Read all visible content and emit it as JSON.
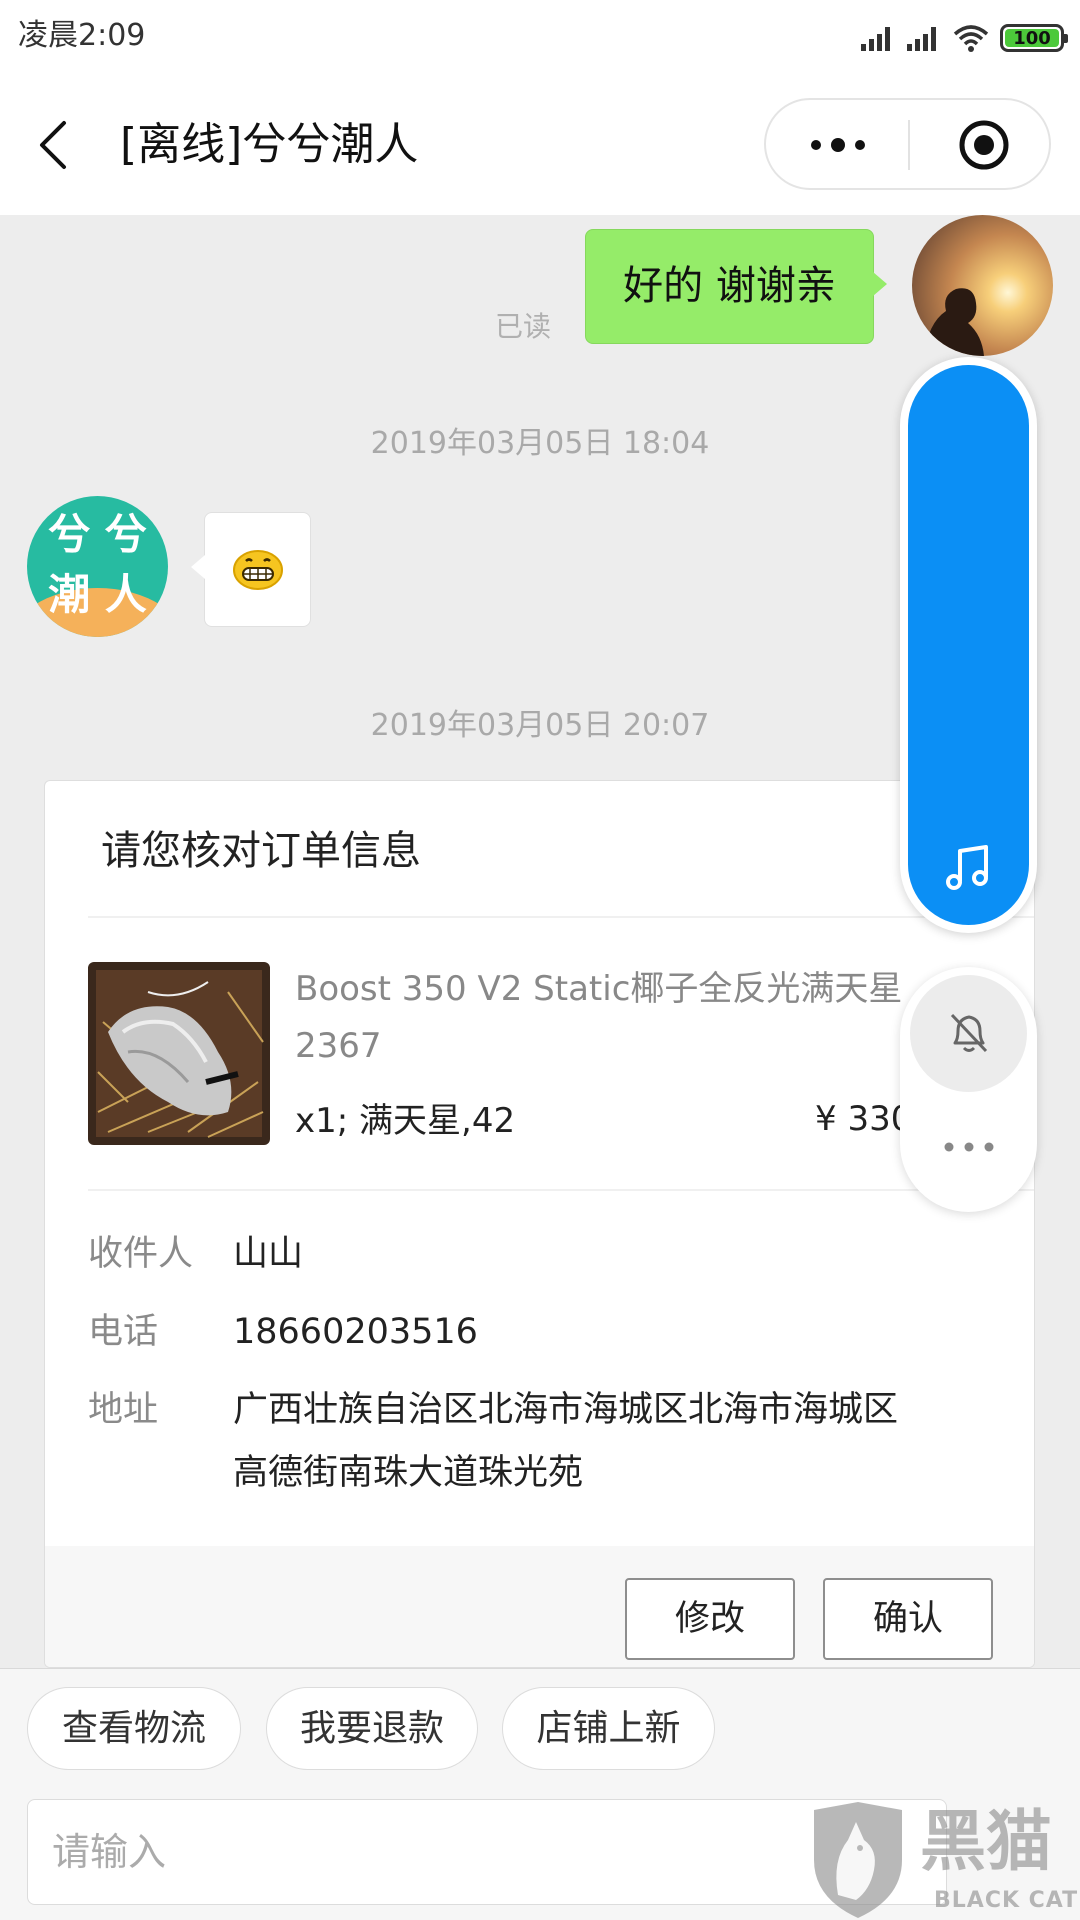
{
  "status_bar": {
    "time": "凌晨2:09",
    "battery": "100",
    "icons": [
      "signal-icon",
      "signal-icon",
      "wifi-icon",
      "battery-icon"
    ]
  },
  "header": {
    "title": "[离线]兮兮潮人",
    "icons": {
      "back": "back-arrow-icon",
      "more": "more-dots-icon",
      "close": "target-circle-icon"
    }
  },
  "chat": {
    "outgoing": {
      "text": "好的 谢谢亲",
      "read_status": "已读"
    },
    "timestamp_1": "2019年03月05日 18:04",
    "shop_avatar": [
      "兮 兮",
      "潮 人"
    ],
    "incoming_emoji": "grinning-emoji",
    "timestamp_2": "2019年03月05日 20:07"
  },
  "order_card": {
    "title": "请您核对订单信息",
    "product": {
      "name_lines": [
        "Boost 350 V2 Static椰子全反光满天星",
        "2367"
      ],
      "spec": "x1; 满天星,42",
      "price": "¥ 330"
    },
    "recipient": {
      "label": "收件人",
      "value": "山山"
    },
    "phone": {
      "label": "电话",
      "value": "18660203516"
    },
    "address": {
      "label": "地址",
      "lines": [
        "广西壮族自治区北海市海城区北海市海城区",
        "高德街南珠大道珠光苑"
      ]
    },
    "buttons": {
      "edit": "修改",
      "confirm": "确认"
    }
  },
  "floating": {
    "music_icon": "music-note-icon",
    "mute_icon": "bell-off-icon",
    "more_icon": "more-dots-icon"
  },
  "quick_actions": [
    "查看物流",
    "我要退款",
    "店铺上新"
  ],
  "input": {
    "placeholder": "请输入"
  },
  "watermark": {
    "cn": "黑猫",
    "en": "BLACK CAT"
  },
  "colors": {
    "outgoing_bubble": "#95ec69",
    "music_widget": "#0b8ff5",
    "chat_bg": "#ededed",
    "battery": "#4cc93a"
  }
}
